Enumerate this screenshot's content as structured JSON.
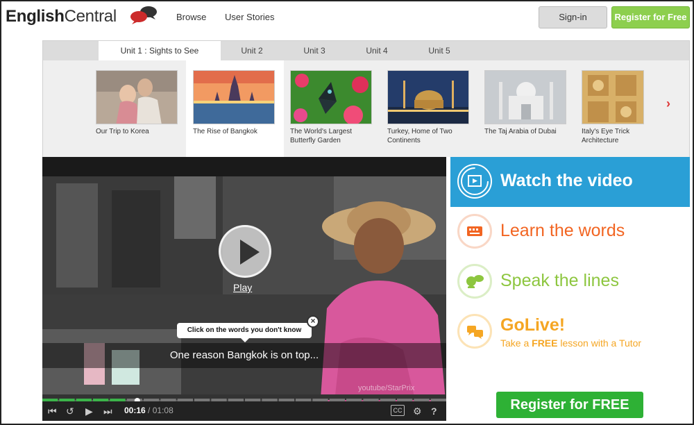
{
  "header": {
    "logo": {
      "part1": "English",
      "part2": "Central"
    },
    "nav": [
      "Browse",
      "User Stories"
    ],
    "signin_label": "Sign-in",
    "register_label": "Register for Free"
  },
  "course": {
    "tabs": [
      "Unit 1 : Sights to See",
      "Unit 2",
      "Unit 3",
      "Unit 4",
      "Unit 5"
    ],
    "active_tab": 0,
    "videos": [
      {
        "title": "Our Trip to Korea"
      },
      {
        "title": "The Rise of Bangkok"
      },
      {
        "title": "The World's Largest Butterfly Garden"
      },
      {
        "title": "Turkey, Home of Two Continents"
      },
      {
        "title": "The Taj Arabia of Dubai"
      },
      {
        "title": "Italy's Eye Trick Architecture"
      }
    ],
    "active_video": 1
  },
  "player": {
    "play_label": "Play",
    "tooltip": "Click on the words you don't know",
    "subtitle": "One reason Bangkok is on top...",
    "watermark": "youtube/StarPrix",
    "time_current": "00:16",
    "time_duration": "/ 01:08",
    "progress_fraction": 0.235,
    "cc_label": "CC"
  },
  "steps": {
    "items": [
      {
        "label": "Watch the video",
        "color": "#ffffff",
        "icon": "video-icon",
        "accent": "#2a9fd6"
      },
      {
        "label": "Learn the words",
        "color": "#f26522",
        "icon": "keyboard-icon",
        "accent": "#f26522"
      },
      {
        "label": "Speak the lines",
        "color": "#8dc63f",
        "icon": "speech-icon",
        "accent": "#8dc63f"
      },
      {
        "label": "GoLive!",
        "color": "#f5a623",
        "icon": "chat-icon",
        "accent": "#f5a623"
      }
    ],
    "golive_sub": {
      "pre": "Take a ",
      "bold": "FREE",
      "post": " lesson with a Tutor"
    },
    "cta_label": "Register for FREE"
  },
  "colors": {
    "brand_blue": "#2a9fd6",
    "brand_green": "#2eb135",
    "header_green": "#8dcf4e",
    "logo_red": "#cc2b2b"
  }
}
